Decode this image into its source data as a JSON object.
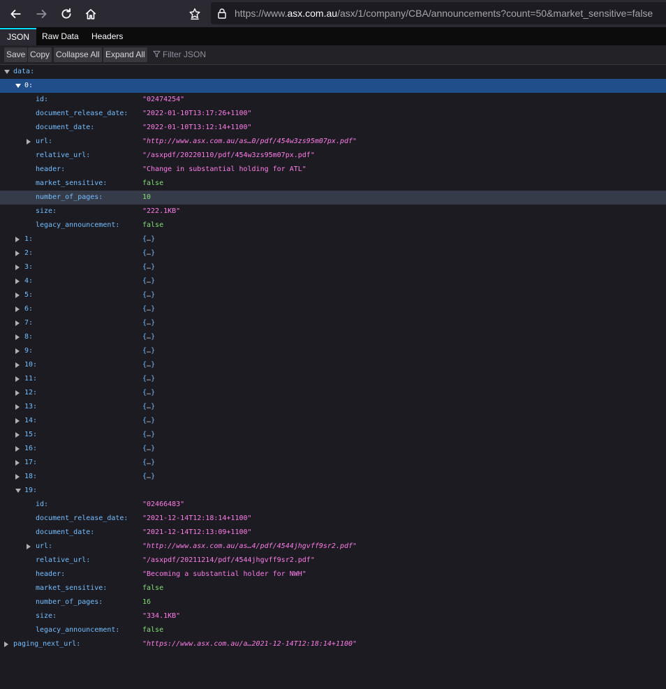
{
  "browser": {
    "url_prefix": "https://www.",
    "url_host": "asx.com.au",
    "url_path": "/asx/1/company/CBA/announcements?count=50&market_sensitive=false"
  },
  "tabs": [
    {
      "label": "JSON"
    },
    {
      "label": "Raw Data"
    },
    {
      "label": "Headers"
    }
  ],
  "json_toolbar": {
    "save": "Save",
    "copy": "Copy",
    "collapse_all": "Collapse All",
    "expand_all": "Expand All",
    "filter_placeholder": "Filter JSON"
  },
  "tree": {
    "data_key": "data:",
    "item0": {
      "key": "0:",
      "fields": [
        {
          "key": "id:",
          "value": "\"02474254\"",
          "type": "str"
        },
        {
          "key": "document_release_date:",
          "value": "\"2022-01-10T13:17:26+1100\"",
          "type": "str"
        },
        {
          "key": "document_date:",
          "value": "\"2022-01-10T13:12:14+1100\"",
          "type": "str"
        },
        {
          "key": "url:",
          "value": "\"http://www.asx.com.au/as…0/pdf/454w3zs95m07px.pdf\"",
          "type": "url",
          "expandable": true
        },
        {
          "key": "relative_url:",
          "value": "\"/asxpdf/20220110/pdf/454w3zs95m07px.pdf\"",
          "type": "str"
        },
        {
          "key": "header:",
          "value": "\"Change in substantial holding for ATL\"",
          "type": "str"
        },
        {
          "key": "market_sensitive:",
          "value": "false",
          "type": "bool"
        },
        {
          "key": "number_of_pages:",
          "value": "10",
          "type": "num",
          "hover": true
        },
        {
          "key": "size:",
          "value": "\"222.1KB\"",
          "type": "str"
        },
        {
          "key": "legacy_announcement:",
          "value": "false",
          "type": "bool"
        }
      ]
    },
    "collapsed_items": [
      "1:",
      "2:",
      "3:",
      "4:",
      "5:",
      "6:",
      "7:",
      "8:",
      "9:",
      "10:",
      "11:",
      "12:",
      "13:",
      "14:",
      "15:",
      "16:",
      "17:",
      "18:"
    ],
    "collapsed_value": "{…}",
    "item19": {
      "key": "19:",
      "fields": [
        {
          "key": "id:",
          "value": "\"02466483\"",
          "type": "str"
        },
        {
          "key": "document_release_date:",
          "value": "\"2021-12-14T12:18:14+1100\"",
          "type": "str"
        },
        {
          "key": "document_date:",
          "value": "\"2021-12-14T12:13:09+1100\"",
          "type": "str"
        },
        {
          "key": "url:",
          "value": "\"http://www.asx.com.au/as…4/pdf/4544jhgvff9sr2.pdf\"",
          "type": "url",
          "expandable": true
        },
        {
          "key": "relative_url:",
          "value": "\"/asxpdf/20211214/pdf/4544jhgvff9sr2.pdf\"",
          "type": "str"
        },
        {
          "key": "header:",
          "value": "\"Becoming a substantial holder for NWH\"",
          "type": "str"
        },
        {
          "key": "market_sensitive:",
          "value": "false",
          "type": "bool"
        },
        {
          "key": "number_of_pages:",
          "value": "16",
          "type": "num"
        },
        {
          "key": "size:",
          "value": "\"334.1KB\"",
          "type": "str"
        },
        {
          "key": "legacy_announcement:",
          "value": "false",
          "type": "bool"
        }
      ]
    },
    "paging": {
      "key": "paging_next_url:",
      "value": "\"https://www.asx.com.au/a…2021-12-14T12:18:14+1100\""
    }
  }
}
